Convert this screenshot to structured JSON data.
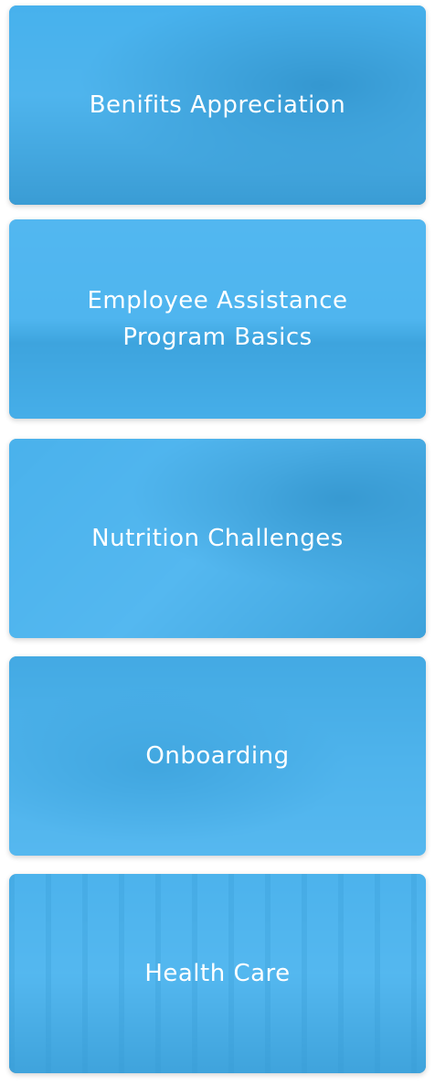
{
  "cards": [
    {
      "label": "Benifits Appreciation"
    },
    {
      "label": "Employee Assistance Program Basics"
    },
    {
      "label": "Nutrition Challenges"
    },
    {
      "label": "Onboarding"
    },
    {
      "label": "Health Care"
    }
  ],
  "colors": {
    "accent_tint": "#3AB0F2",
    "label_text": "#FFFFFF"
  }
}
